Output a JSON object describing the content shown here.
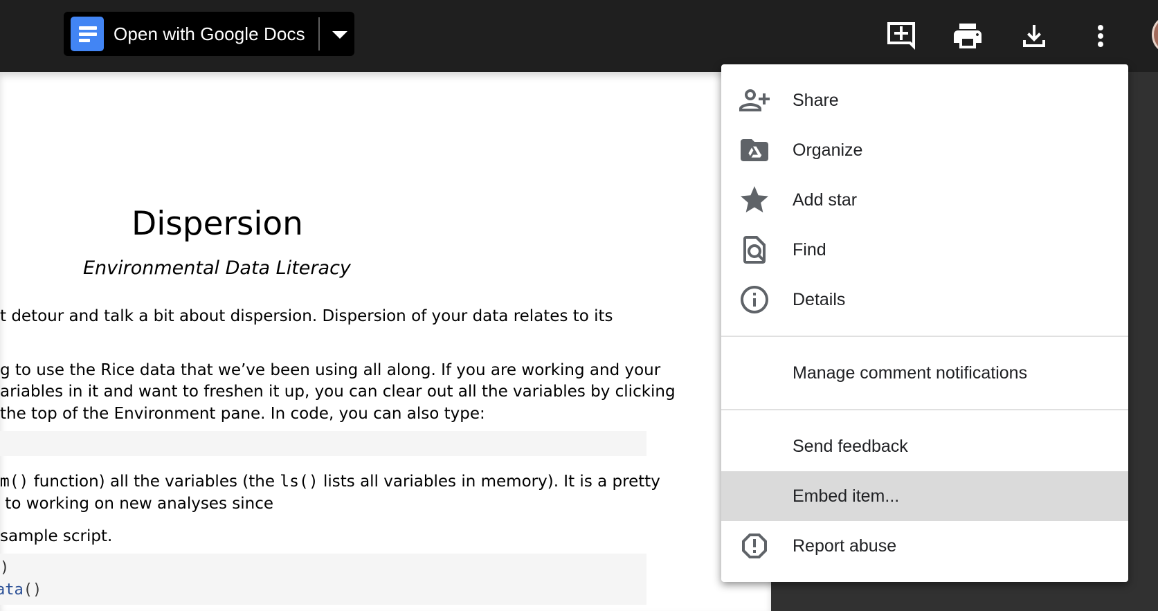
{
  "toolbar": {
    "open_with_label": "Open with Google Docs",
    "icons": [
      "add-comment-icon",
      "print-icon",
      "download-icon",
      "more-vert-icon"
    ]
  },
  "document": {
    "title": "Dispersion",
    "subtitle": "Environmental Data Literacy",
    "para1_line1": "t detour and talk a bit about dispersion. Dispersion of your data relates to its",
    "para2_line1": "g to use the Rice data that we’ve been using all along. If you are working and your",
    "para2_line2": "ariables in it and want to freshen it up, you can clear out all the variables by clicking",
    "para2_line3": "the top of the Environment pane.  In code, you can also type:",
    "para3_code_rm": "rm()",
    "para3_text_a": " function) all the variables (the ",
    "para3_code_ls": "ls()",
    "para3_text_b": " lists all variables in memory). It is a pretty",
    "para3_line2": " to working on new analyses since",
    "para4_line1": "sample script.",
    "code_line1": ")",
    "code_line2_fn": "ata",
    "code_line2_rest": "()"
  },
  "menu": {
    "share": "Share",
    "organize": "Organize",
    "add_star": "Add star",
    "find": "Find",
    "details": "Details",
    "manage_notifications": "Manage comment notifications",
    "send_feedback": "Send feedback",
    "embed_item": "Embed item...",
    "report_abuse": "Report abuse"
  },
  "colors": {
    "topbar": "#1f1f1f",
    "docs_blue": "#4285f4",
    "menu_highlight": "#dadada"
  }
}
